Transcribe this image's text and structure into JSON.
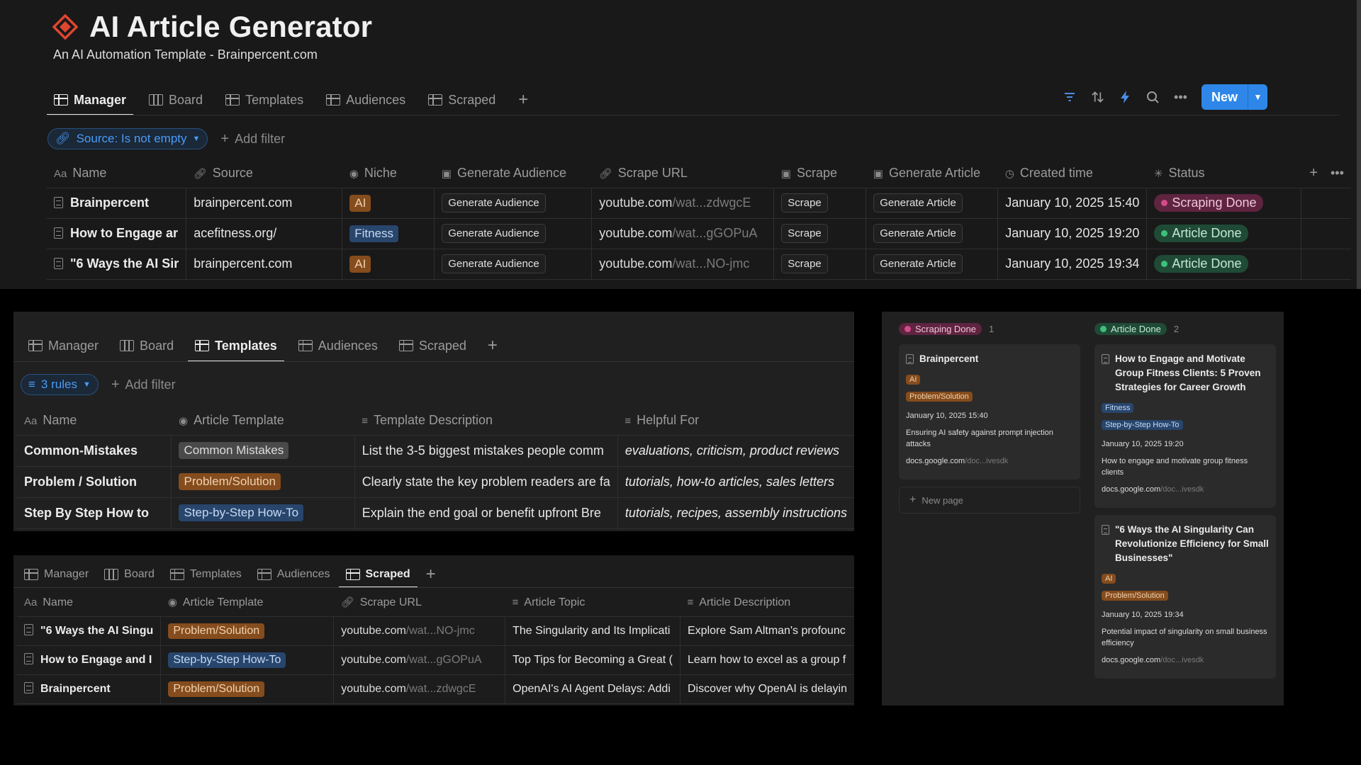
{
  "header": {
    "title": "AI Article Generator",
    "subtitle": "An AI Automation Template - Brainpercent.com"
  },
  "views": {
    "tabs": [
      "Manager",
      "Board",
      "Templates",
      "Audiences",
      "Scraped"
    ]
  },
  "toolbar": {
    "icons": [
      "filter-icon",
      "sort-icon",
      "lightning-icon",
      "search-icon",
      "more-icon"
    ],
    "new_label": "New"
  },
  "manager": {
    "filter_label": "Source: Is not empty",
    "add_filter": "Add filter",
    "columns": [
      "Name",
      "Source",
      "Niche",
      "Generate Audience",
      "Scrape URL",
      "Scrape",
      "Generate Article",
      "Created time",
      "Status"
    ],
    "rows": [
      {
        "name": "Brainpercent",
        "source": "brainpercent.com",
        "niche": "AI",
        "gen_audience": "Generate Audience",
        "url_main": "youtube.com",
        "url_rest": "/wat...zdwgcE",
        "scrape": "Scrape",
        "gen_article": "Generate Article",
        "created": "January 10, 2025 15:40",
        "status": "Scraping Done"
      },
      {
        "name": "How to Engage ar",
        "source": "acefitness.org/",
        "niche": "Fitness",
        "gen_audience": "Generate Audience",
        "url_main": "youtube.com",
        "url_rest": "/wat...gGOPuA",
        "scrape": "Scrape",
        "gen_article": "Generate Article",
        "created": "January 10, 2025 19:20",
        "status": "Article Done"
      },
      {
        "name": "\"6 Ways the AI Sir",
        "source": "brainpercent.com",
        "niche": "AI",
        "gen_audience": "Generate Audience",
        "url_main": "youtube.com",
        "url_rest": "/wat...NO-jmc",
        "scrape": "Scrape",
        "gen_article": "Generate Article",
        "created": "January 10, 2025 19:34",
        "status": "Article Done"
      }
    ]
  },
  "templates": {
    "filter_label": "3 rules",
    "add_filter": "Add filter",
    "columns": [
      "Name",
      "Article Template",
      "Template Description",
      "Helpful For"
    ],
    "rows": [
      {
        "name": "Common-Mistakes",
        "template": "Common Mistakes",
        "description": "List the 3-5 biggest mistakes people comm",
        "helpful": "evaluations, criticism, product reviews"
      },
      {
        "name": "Problem / Solution",
        "template": "Problem/Solution",
        "description": "Clearly state the key problem readers are fa",
        "helpful": "tutorials, how-to articles, sales letters"
      },
      {
        "name": "Step By Step How to",
        "template": "Step-by-Step How-To",
        "description": "Explain the end goal or benefit upfront Bre",
        "helpful": "tutorials, recipes, assembly instructions"
      }
    ]
  },
  "scraped": {
    "columns": [
      "Name",
      "Article Template",
      "Scrape URL",
      "Article Topic",
      "Article Description"
    ],
    "rows": [
      {
        "name": "\"6 Ways the AI Singu",
        "template": "Problem/Solution",
        "url_main": "youtube.com",
        "url_rest": "/wat...NO-jmc",
        "topic": "The Singularity and Its Implicati",
        "description": "Explore Sam Altman's profounc"
      },
      {
        "name": "How to Engage and I",
        "template": "Step-by-Step How-To",
        "url_main": "youtube.com",
        "url_rest": "/wat...gGOPuA",
        "topic": "Top Tips for Becoming a Great (",
        "description": "Learn how to excel as a group f"
      },
      {
        "name": "Brainpercent",
        "template": "Problem/Solution",
        "url_main": "youtube.com",
        "url_rest": "/wat...zdwgcE",
        "topic": "OpenAI's AI Agent Delays: Addi",
        "description": "Discover why OpenAI is delayin"
      }
    ]
  },
  "board": {
    "columns": [
      {
        "status": "Scraping Done",
        "count": "1",
        "cards": [
          {
            "title": "Brainpercent",
            "tags": [
              "AI",
              "Problem/Solution"
            ],
            "created": "January 10, 2025 15:40",
            "topic": "Ensuring AI safety against prompt injection attacks",
            "link_main": "docs.google.com",
            "link_rest": "/doc...ivesdk"
          }
        ],
        "new_page": "New page"
      },
      {
        "status": "Article Done",
        "count": "2",
        "cards": [
          {
            "title": "How to Engage and Motivate Group Fitness Clients: 5 Proven Strategies for Career Growth",
            "tags": [
              "Fitness",
              "Step-by-Step How-To"
            ],
            "created": "January 10, 2025 19:20",
            "topic": "How to engage and motivate group fitness clients",
            "link_main": "docs.google.com",
            "link_rest": "/doc...ivesdk"
          },
          {
            "title": "\"6 Ways the AI Singularity Can Revolutionize Efficiency for Small Businesses\"",
            "tags": [
              "AI",
              "Problem/Solution"
            ],
            "created": "January 10, 2025 19:34",
            "topic": "Potential impact of singularity on small business efficiency",
            "link_main": "docs.google.com",
            "link_rest": "/doc...ivesdk"
          }
        ]
      }
    ]
  },
  "colors": {
    "accent_blue": "#2e87e8",
    "tag_orange": "#854c1d",
    "tag_blue": "#28456c",
    "status_pink": "#d44c8a",
    "status_green": "#3ec07c",
    "logo_red": "#e0452f"
  }
}
